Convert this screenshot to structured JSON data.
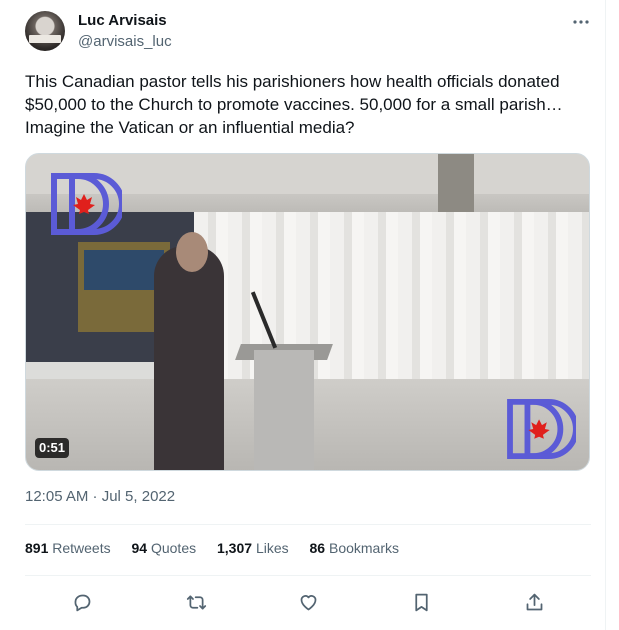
{
  "author": {
    "name": "Luc Arvisais",
    "handle": "@arvisais_luc",
    "avatar_icon": "profile-photo"
  },
  "more_icon": "more-horizontal-icon",
  "tweet": {
    "text": "This Canadian pastor tells his parishioners how health officials donated\n$50,000 to the Church to promote vaccines. 50,000 for a small parish…\nImagine the Vatican or an influential media?",
    "timestamp": "12:05 AM · Jul 5, 2022"
  },
  "media": {
    "duration": "0:51",
    "logo_color": "#5b5bd6",
    "leaf_color": "#e0201c"
  },
  "stats": {
    "retweets": {
      "num": "891",
      "label": "Retweets"
    },
    "quotes": {
      "num": "94",
      "label": "Quotes"
    },
    "likes": {
      "num": "1,307",
      "label": "Likes"
    },
    "bookmarks": {
      "num": "86",
      "label": "Bookmarks"
    }
  },
  "actions": [
    "reply-icon",
    "retweet-icon",
    "like-icon",
    "bookmark-icon",
    "share-icon"
  ],
  "colors": {
    "text": "#0f1419",
    "secondary": "#536471",
    "divider": "#eff3f4"
  }
}
